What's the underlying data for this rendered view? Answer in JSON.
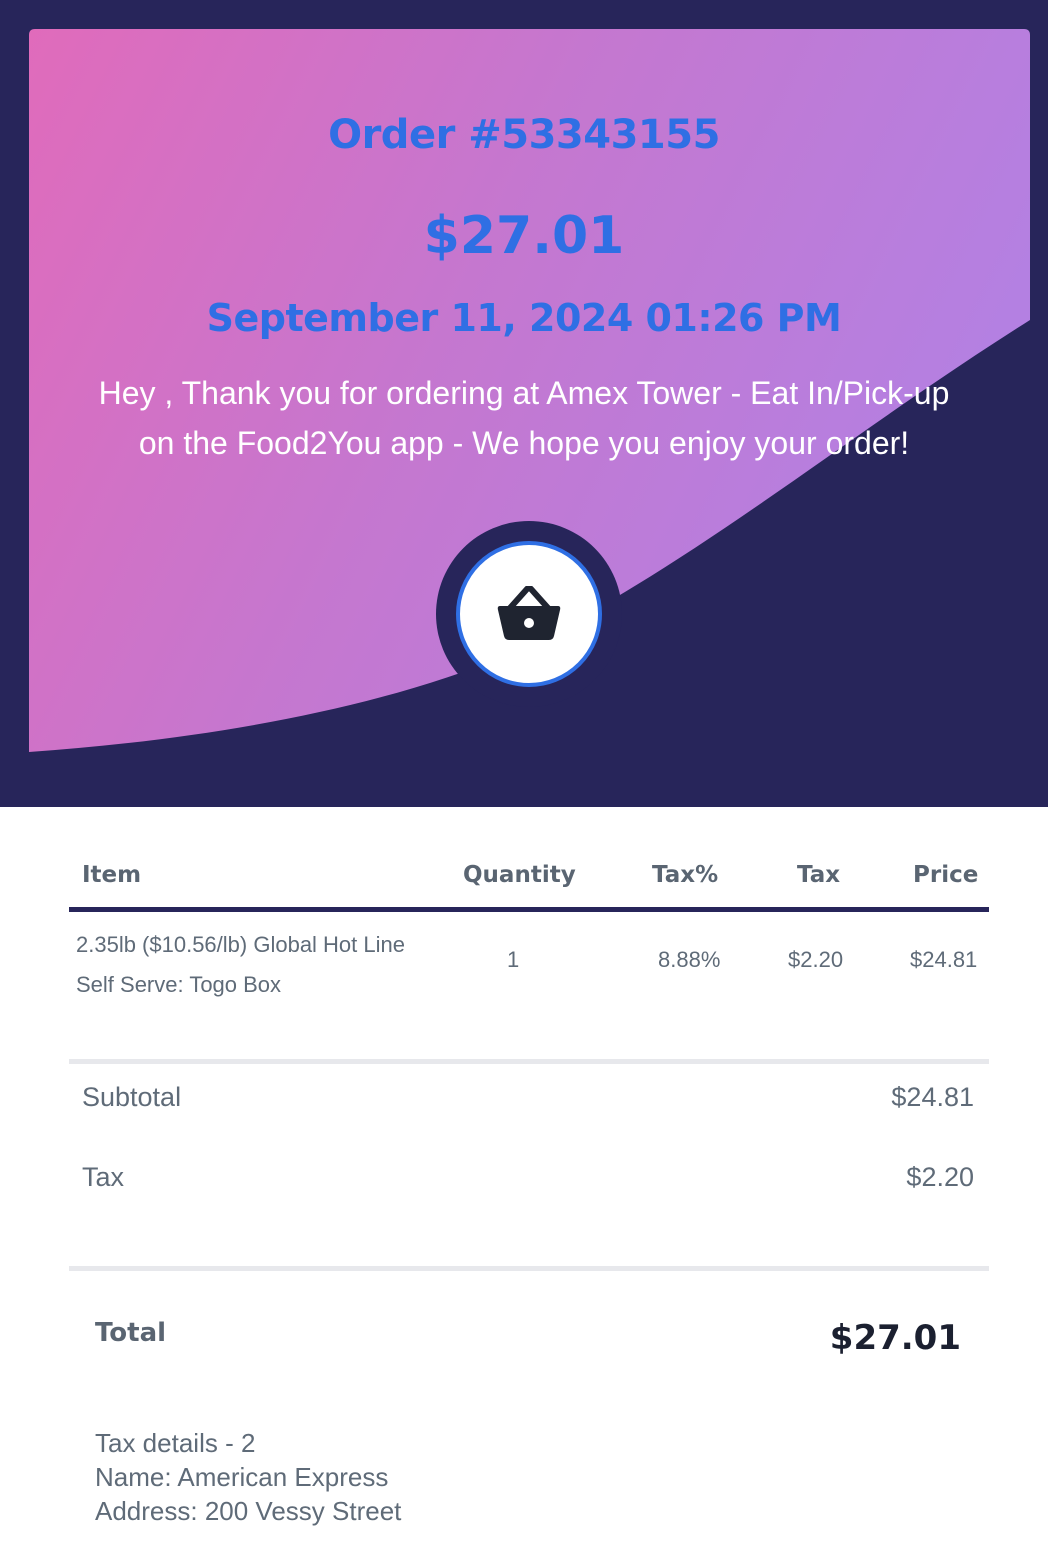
{
  "header": {
    "order_number": "Order #53343155",
    "amount": "$27.01",
    "datetime": "September 11, 2024 01:26 PM",
    "thanks_line1": "Hey , Thank you for ordering at Amex Tower - Eat In/Pick-up",
    "thanks_line2": "on the Food2You app - We hope you enjoy your order!",
    "icon": "shopping-basket-icon"
  },
  "table": {
    "columns": [
      "Item",
      "Quantity",
      "Tax%",
      "Tax",
      "Price"
    ],
    "rows": [
      {
        "item_line1": "2.35lb ($10.56/lb) Global Hot Line",
        "item_line2": "Self Serve: Togo Box",
        "quantity": "1",
        "tax_percent": "8.88%",
        "tax": "$2.20",
        "price": "$24.81"
      }
    ]
  },
  "summary": {
    "subtotal_label": "Subtotal",
    "subtotal_value": "$24.81",
    "tax_label": "Tax",
    "tax_value": "$2.20",
    "total_label": "Total",
    "total_value": "$27.01"
  },
  "tax_details": {
    "line1": "Tax details - 2",
    "line2": "Name: American Express",
    "line3": "Address: 200 Vessy Street"
  },
  "colors": {
    "navy": "#27255a",
    "accent_blue": "#2f6fe4",
    "gradient_start": "#e06bbb",
    "gradient_end": "#b480e2"
  }
}
